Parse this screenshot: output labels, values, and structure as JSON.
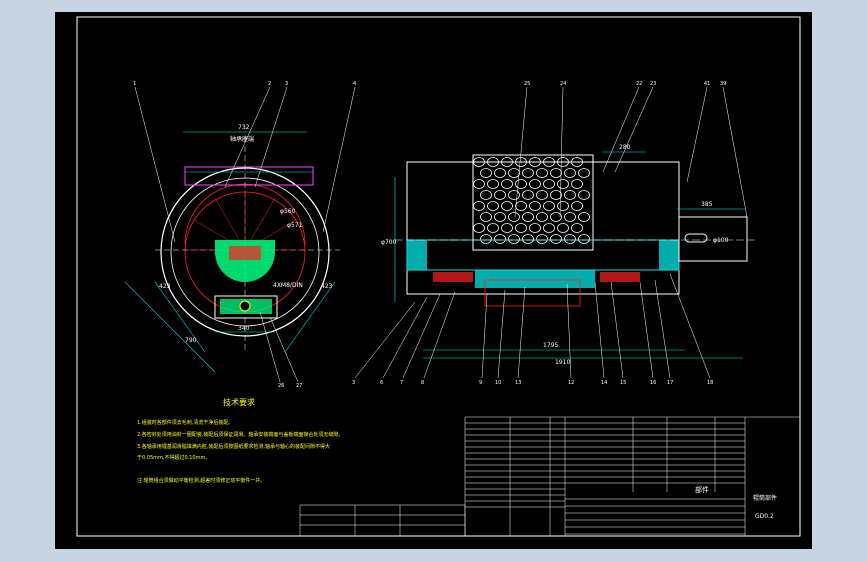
{
  "drawing": {
    "title_block": {
      "part_name": "辊筒部件",
      "assembly_label": "部件",
      "drawing_no": "GD0.2"
    },
    "tech_requirements": {
      "heading": "技术要求",
      "items": [
        "1.组装时各部件须去毛刺,清洗干净后装配。",
        "2.各密封处须用油封一圈配装,装配后须保证润滑。轴承安装端面与盖板端面接合处须无缝隙。",
        "3.各轴承用锂基润滑脂填满内腔,装配后须按图纸要求检测,轴承与轴心的装配间隙不得大",
        "于0.05mm,不得超过0.10mm。",
        "注:辊筒组合须做动平衡检测,超差时须修正动平衡件一并。"
      ]
    },
    "dimensions": {
      "d_width_top": "732",
      "d_label_top": "轴承座端",
      "d_phi_a": "φ560",
      "d_phi_b": "φ571",
      "d_phi_c": "4XM8/DIN",
      "d_bottom": "340",
      "d_diag_left": "423",
      "d_diag_right": "423",
      "d_bottom_long": "790",
      "d_height": "φ700",
      "d_top_small": "280",
      "d_shaft": "385",
      "d_shaft_phi": "φ100",
      "d_total_a": "1795",
      "d_total_b": "1910"
    },
    "callouts_left": [
      "1",
      "2",
      "3",
      "4",
      "26",
      "27"
    ],
    "callouts_top": [
      "25",
      "24",
      "22",
      "23",
      "41",
      "39"
    ],
    "callouts_bottom": [
      "3",
      "6",
      "7",
      "8",
      "9",
      "10",
      "13",
      "12",
      "14",
      "15",
      "16",
      "17",
      "18"
    ]
  },
  "colors": {
    "background": "#c6d3e2",
    "sheet": "#000000",
    "line": "#ffffff",
    "red": "#ff2020",
    "green": "#00ff80",
    "cyan": "#00e6e6",
    "yellow": "#ffff00",
    "magenta": "#ff40ff"
  }
}
